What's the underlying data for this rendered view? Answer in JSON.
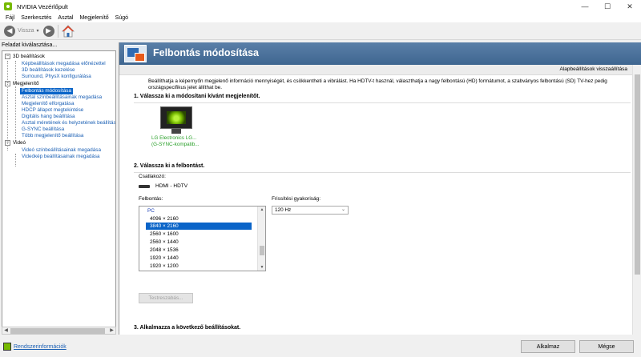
{
  "window": {
    "title": "NVIDIA Vezérlőpult",
    "minimize": "—",
    "maximize": "☐",
    "close": "✕"
  },
  "menu": [
    "Fájl",
    "Szerkesztés",
    "Asztal",
    "Megjelenítő",
    "Súgó"
  ],
  "toolbar": {
    "back_label": "Vissza",
    "back_glyph": "◀",
    "forward_glyph": "▶",
    "dropdown_glyph": "▾"
  },
  "task_panel": {
    "label": "Feladat kiválasztása...",
    "categories": [
      {
        "label": "3D beállítások",
        "items": [
          "Képbeállítások megadása előnézettel",
          "3D beállítások kezelése",
          "Surround, PhysX konfigurálása"
        ]
      },
      {
        "label": "Megjelenítő",
        "items": [
          "Felbontás módosítása",
          "Asztal színbeállításainak megadása",
          "Megjelenítő elforgatása",
          "HDCP állapot megtekintése",
          "Digitális hang beállítása",
          "Asztal méretének és helyzetének beállítása",
          "G-SYNC beállítása",
          "Több megjelenítő beállítása"
        ]
      },
      {
        "label": "Videó",
        "items": [
          "Videó színbeállításainak megadása",
          "Videókép beállításainak megadása"
        ]
      }
    ],
    "selected_item": "Felbontás módosítása",
    "system_info": "Rendszerinformációk"
  },
  "content": {
    "title": "Felbontás módosítása",
    "restore_defaults": "Alapbeállítások visszaállítása",
    "description": "Beállíthatja a képernyőn megjelenő információ mennyiségét, és csökkentheti a vibrálást. Ha HDTV-t használ, választhatja a nagy felbontású (HD) formátumot, a szabványos felbontású (SD) TV-hez pedig országspecifikus jelet állíthat be.",
    "step1": {
      "title": "1. Válassza ki a módosítani kívánt megjelenítőt.",
      "monitor_line1": "LG Electronics LG...",
      "monitor_line2": "(G-SYNC-kompatib..."
    },
    "step2": {
      "title": "2. Válassza ki a felbontást.",
      "connector_label": "Csatlakozó:",
      "connector_value": "HDMI - HDTV",
      "resolution_label": "Felbontás:",
      "refresh_label": "Frissítési gyakoriság:",
      "refresh_value": "120 Hz",
      "resolution_group": "PC",
      "resolutions": [
        "4096 × 2160",
        "3840 × 2160",
        "2560 × 1600",
        "2560 × 1440",
        "2048 × 1536",
        "1920 × 1440",
        "1920 × 1200"
      ],
      "selected_resolution": "3840 × 2160",
      "customize_button": "Testreszabás..."
    },
    "step3": {
      "title": "3. Alkalmazza a következő beállításokat."
    }
  },
  "buttons": {
    "apply": "Alkalmaz",
    "cancel": "Mégse"
  },
  "colors": {
    "nvidia_green": "#76b900",
    "selection_blue": "#0a64c8",
    "header_blue": "#4a739c"
  }
}
